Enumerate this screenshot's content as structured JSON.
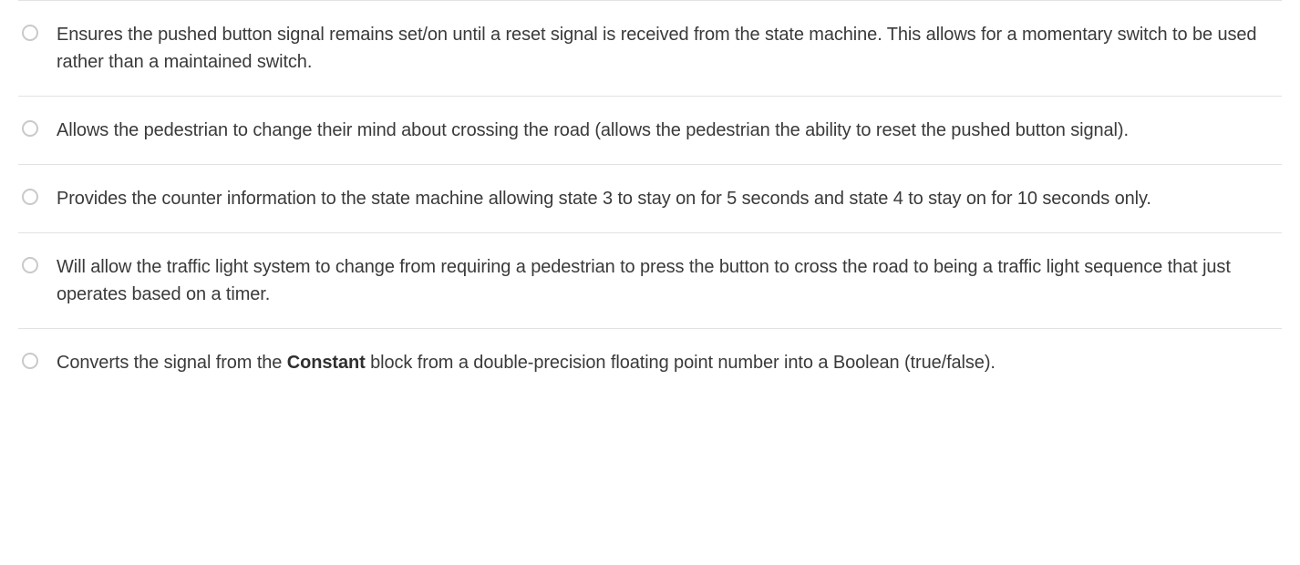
{
  "options": [
    {
      "text": "Ensures the pushed button signal remains set/on until a reset signal is received from the state machine. This allows for a momentary switch to be used rather than a maintained switch."
    },
    {
      "text": "Allows the pedestrian to change their mind about crossing the road (allows the pedestrian the ability to reset the pushed button signal)."
    },
    {
      "text": "Provides the counter information to the state machine allowing state 3 to stay on for 5 seconds and state 4 to stay on for 10 seconds only."
    },
    {
      "text": "Will allow the traffic light system to change from requiring a pedestrian to press the button to cross the road to being a traffic light sequence that just operates based on a timer."
    },
    {
      "text_pre": "Converts the signal from the ",
      "text_bold": "Constant",
      "text_post": " block from a double-precision floating point number into a Boolean (true/false)."
    }
  ]
}
